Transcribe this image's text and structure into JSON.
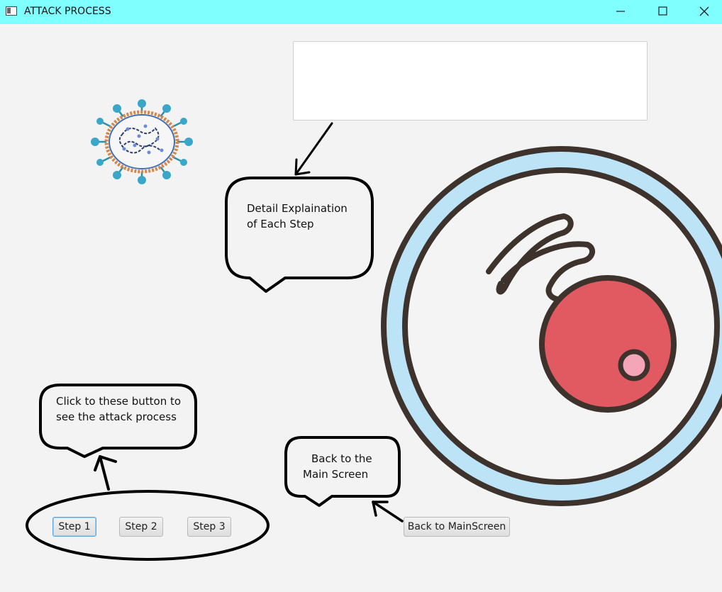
{
  "window": {
    "title": "ATTACK PROCESS",
    "minimize_glyph": "—",
    "maximize_glyph": "☐",
    "close_glyph": "✕"
  },
  "detail_textarea": {
    "value": ""
  },
  "callouts": {
    "detail_line1": "Detail Explaination",
    "detail_line2": "of Each Step",
    "buttons_line1": "Click to these button to",
    "buttons_line2": "see the attack process",
    "back_line1": "Back to the",
    "back_line2": "Main Screen"
  },
  "buttons": {
    "step1": "Step 1",
    "step2": "Step 2",
    "step3": "Step 3",
    "back": "Back to MainScreen"
  },
  "icons": {
    "virus": "virus-icon",
    "cell": "cell-icon",
    "app": "app-icon"
  },
  "colors": {
    "titlebar": "#80ffff",
    "cell_ring": "#bde3f7",
    "cell_outline": "#3d322c",
    "nucleus": "#e15a62",
    "nucleolus": "#f5a5b8",
    "focus": "#5aa6e0"
  }
}
